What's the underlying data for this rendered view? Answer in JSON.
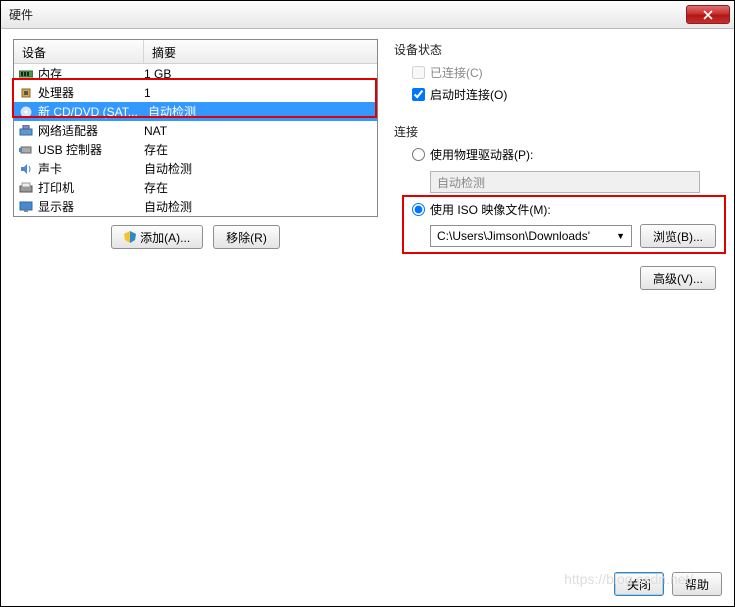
{
  "window": {
    "title": "硬件"
  },
  "left": {
    "header_device": "设备",
    "header_summary": "摘要",
    "rows": [
      {
        "name": "内存",
        "summary": "1 GB",
        "icon": "memory"
      },
      {
        "name": "处理器",
        "summary": "1",
        "icon": "cpu"
      },
      {
        "name": "新 CD/DVD (SAT...",
        "summary": "自动检测",
        "icon": "cd",
        "selected": true
      },
      {
        "name": "网络适配器",
        "summary": "NAT",
        "icon": "network"
      },
      {
        "name": "USB 控制器",
        "summary": "存在",
        "icon": "usb"
      },
      {
        "name": "声卡",
        "summary": "自动检测",
        "icon": "sound"
      },
      {
        "name": "打印机",
        "summary": "存在",
        "icon": "printer"
      },
      {
        "name": "显示器",
        "summary": "自动检测",
        "icon": "display"
      }
    ],
    "add_btn": "添加(A)...",
    "remove_btn": "移除(R)"
  },
  "right": {
    "status_title": "设备状态",
    "connected": "已连接(C)",
    "connect_at_power": "启动时连接(O)",
    "conn_title": "连接",
    "use_physical": "使用物理驱动器(P):",
    "autodetect": "自动检测",
    "use_iso": "使用 ISO 映像文件(M):",
    "iso_path": "C:\\Users\\Jimson\\Downloads'",
    "browse": "浏览(B)...",
    "advanced": "高级(V)..."
  },
  "footer": {
    "close": "关闭",
    "help": "帮助"
  },
  "watermark": "https://blog.csdn.net/..."
}
